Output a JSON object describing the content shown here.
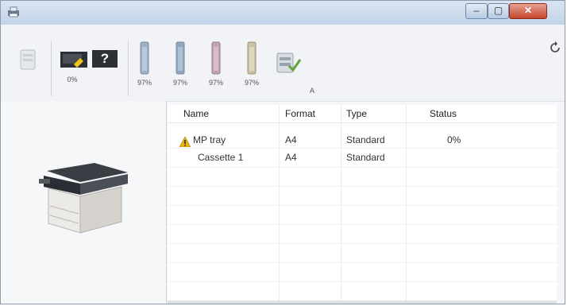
{
  "window": {
    "icon": "printer-icon",
    "buttons": {
      "minimize": "–",
      "maximize": "▢",
      "close": "✕"
    }
  },
  "toolbar": {
    "device_icon": "printer-status-icon",
    "panel_counter": "?",
    "panel_percent": "0%",
    "toners": [
      {
        "name": "toner-cyan",
        "color": "#9ab1c8",
        "percent": "97%"
      },
      {
        "name": "toner-blue",
        "color": "#8ea8c4",
        "percent": "97%"
      },
      {
        "name": "toner-magenta",
        "color": "#c5a3b7",
        "percent": "97%"
      },
      {
        "name": "toner-yellow",
        "color": "#c9c3a4",
        "percent": "97%"
      }
    ],
    "waste_icon": "waste-toner-icon",
    "waste_label": "A",
    "refresh_icon": "refresh-icon"
  },
  "list": {
    "columns": [
      "Name",
      "Format",
      "Type",
      "Status"
    ],
    "rows": [
      {
        "warning": true,
        "name": "MP tray",
        "format": "A4",
        "type": "Standard",
        "status": "0%"
      },
      {
        "warning": false,
        "name": "Cassette 1",
        "format": "A4",
        "type": "Standard",
        "status": ""
      }
    ]
  },
  "colors": {
    "title_bar": "#c3d4e8",
    "close_button": "#c4452c",
    "warning": "#e6b21c"
  }
}
